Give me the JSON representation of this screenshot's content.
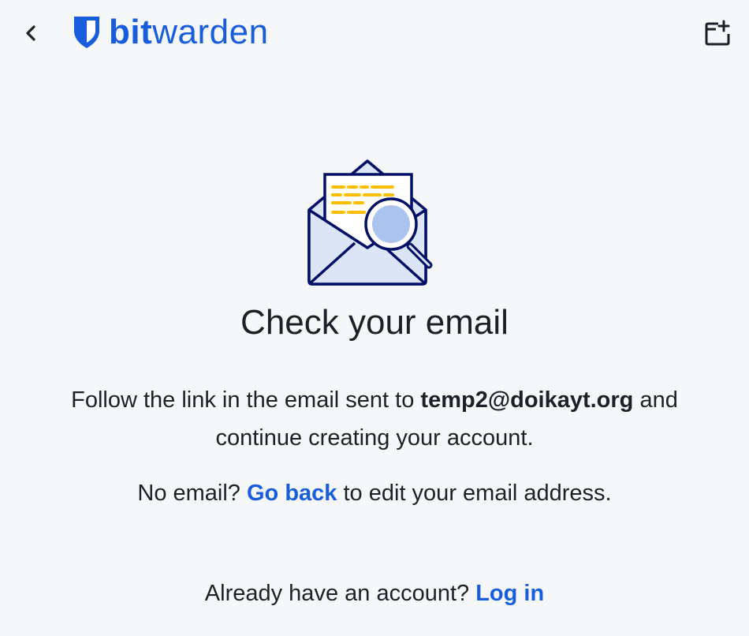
{
  "header": {
    "back_icon": "chevron-left-icon",
    "logo": {
      "bold": "bit",
      "regular": "warden",
      "color": "#175ddc"
    },
    "popout_icon": "popout-window-icon"
  },
  "main": {
    "illustration": "envelope-magnifier-icon",
    "title": "Check your email",
    "instructions_prefix": "Follow the link in the email sent to",
    "email": "temp2@doikayt.org",
    "instructions_suffix_line1": "and",
    "instructions_line2": "continue creating your account.",
    "no_email_prefix": "No email?",
    "go_back_link": "Go back",
    "no_email_suffix": "to edit your email address."
  },
  "footer": {
    "already_text": "Already have an account?",
    "login_link": "Log in"
  },
  "colors": {
    "background": "#f6f7f9",
    "accent": "#175ddc",
    "text": "#1b2029",
    "illustration_stroke": "#020f66",
    "illustration_fill": "#dbe5f6",
    "highlight_yellow": "#ffbf00"
  }
}
